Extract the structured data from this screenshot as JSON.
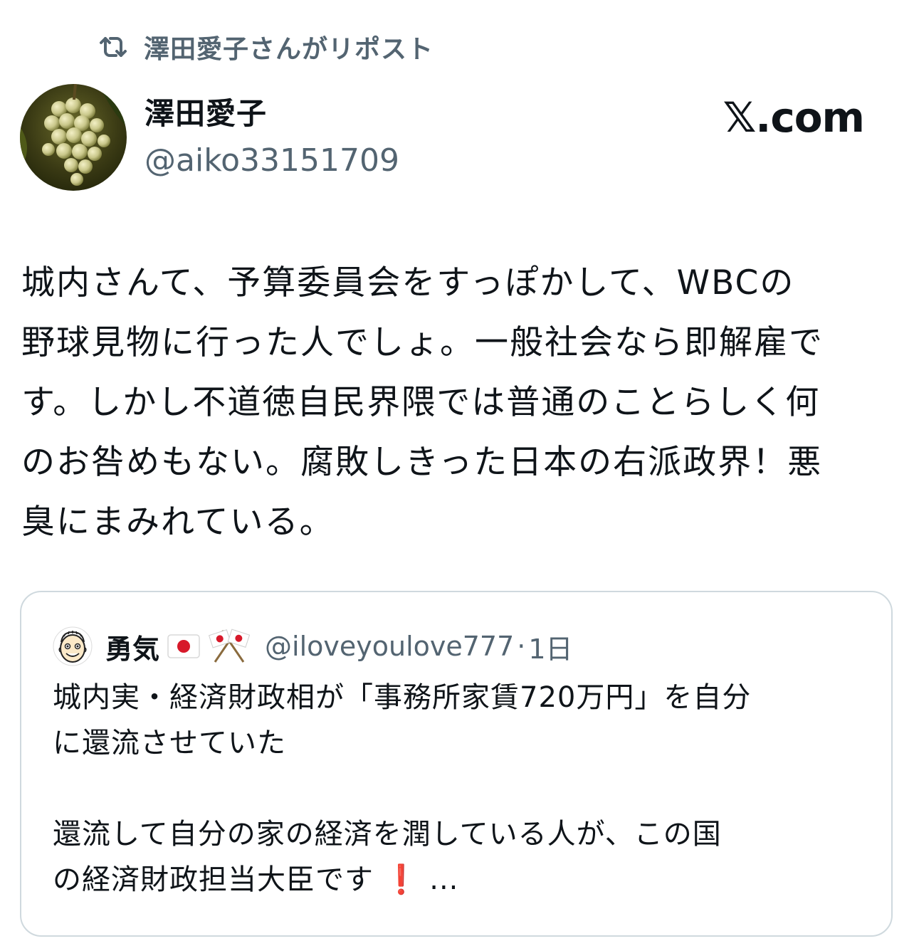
{
  "repost": {
    "icon": "repost-icon",
    "text": "澤田愛子さんがリポスト"
  },
  "author": {
    "display_name": "澤田愛子",
    "handle": "@aiko33151709",
    "avatar": "grape-cluster-avatar"
  },
  "brand": {
    "label": "𝕏.com"
  },
  "tweet": {
    "text": "城内さんて、予算委員会をすっぽかして、WBCの\n野球見物に行った人でしょ。一般社会なら即解雇で\nす。しかし不道徳自民界隈では普通のことらしく何\nのお咎めもない。腐敗しきった日本の右派政界！悪\n臭にまみれている。"
  },
  "quote": {
    "avatar": "cartoon-face-avatar",
    "name": "勇気",
    "name_emojis": [
      "japan-flag-emoji",
      "crossed-flags-emoji"
    ],
    "handle": "@iloveyoulove777",
    "separator": "·",
    "time": "1日",
    "text_main": "城内実・経済財政相が「事務所家賃720万円」を自分\nに還流させていた\n\n還流して自分の家の経済を潤している人が、この国\nの経済財政担当大臣です",
    "text_emoji": "❗",
    "text_ellipsis": " ...",
    "accent_color": "#e0232e",
    "border_color": "#cfd9de",
    "secondary_text_color": "#536471"
  }
}
